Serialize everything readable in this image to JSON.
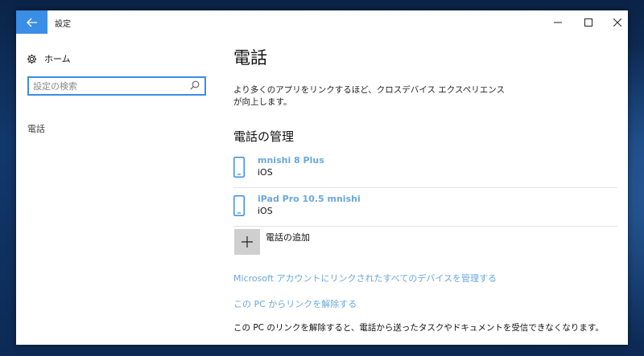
{
  "window": {
    "title": "設定",
    "controls": {
      "minimize_icon": "minimize-icon",
      "maximize_icon": "maximize-icon",
      "close_icon": "close-icon"
    },
    "accent_color": "#3a8ee6"
  },
  "sidebar": {
    "home_label": "ホーム",
    "search_placeholder": "設定の検索",
    "nav_items": [
      {
        "label": "電話"
      }
    ]
  },
  "main": {
    "title": "電話",
    "description": "より多くのアプリをリンクするほど、クロスデバイス エクスペリエンスが向上します。",
    "manage_heading": "電話の管理",
    "devices": [
      {
        "name": "mnishi 8 Plus",
        "os": "iOS"
      },
      {
        "name": "iPad Pro 10.5 mnishi",
        "os": "iOS"
      }
    ],
    "add_phone_label": "電話の追加",
    "manage_all_link": "Microsoft アカウントにリンクされたすべてのデバイスを管理する",
    "unlink_link": "この PC からリンクを解除する",
    "unlink_note": "この PC のリンクを解除すると、電話から送ったタスクやドキュメントを受信できなくなります。",
    "link_color": "#6aa7dc"
  }
}
